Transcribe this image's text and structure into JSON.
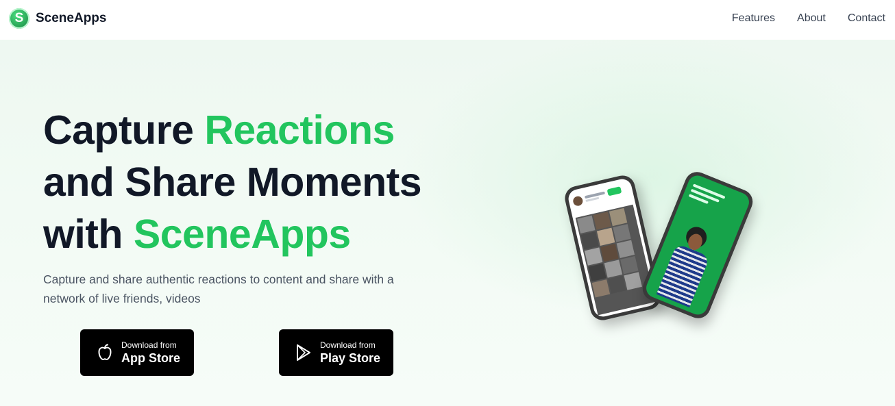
{
  "nav": {
    "brand_initial": "S",
    "brand_name": "SceneApps",
    "links": [
      "Features",
      "About",
      "Contact"
    ]
  },
  "hero": {
    "title_line1_a": "Capture ",
    "title_line1_b": "Reactions",
    "title_line2": "and Share Moments",
    "title_line3_a": "with ",
    "title_line3_b": "SceneApps",
    "subtitle": "Capture and share authentic reactions to content and share with a network of live friends, videos"
  },
  "buttons": {
    "app_store": {
      "small": "Download from",
      "big": "App Store",
      "icon": "apple-icon"
    },
    "play_store": {
      "small": "Download from",
      "big": "Play Store",
      "icon": "play-icon"
    }
  },
  "colors": {
    "accent": "#22c55e",
    "heading": "#111827",
    "button_bg": "#000000"
  }
}
